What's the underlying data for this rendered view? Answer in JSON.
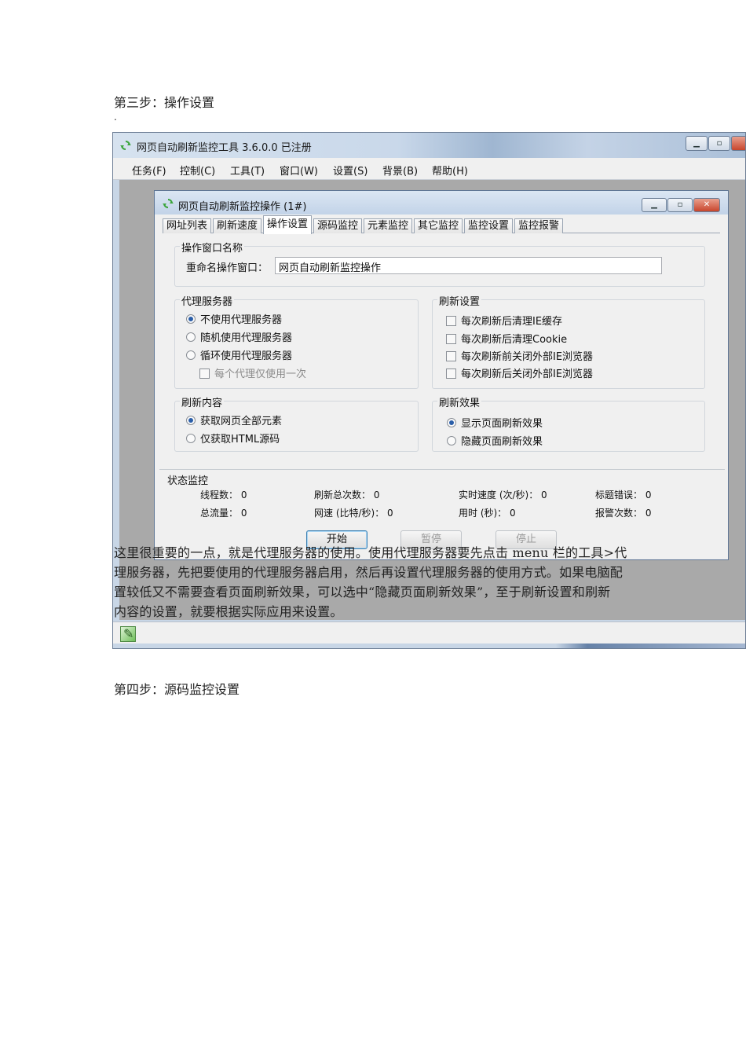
{
  "document": {
    "step3_heading": "第三步：操作设置",
    "stray_dot": ".",
    "step4_heading": "第四步：源码监控设置",
    "paragraph_lines": [
      "这里很重要的一点，就是代理服务器的使用。使用代理服务器要先点击 menu 栏的工具>代",
      "理服务器，先把要使用的代理服务器启用，然后再设置代理服务器的使用方式。如果电脑配",
      "置较低又不需要查看页面刷新效果，可以选中“隐藏页面刷新效果”，至于刷新设置和刷新",
      "内容的设置，就要根据实际应用来设置。"
    ]
  },
  "main_window": {
    "title": "网页自动刷新监控工具 3.6.0.0  已注册",
    "menu": [
      "任务(F)",
      "控制(C)",
      "工具(T)",
      "窗口(W)",
      "设置(S)",
      "背景(B)",
      "帮助(H)"
    ]
  },
  "child_window": {
    "title": "网页自动刷新监控操作  (1#)",
    "tabs": [
      "网址列表",
      "刷新速度",
      "操作设置",
      "源码监控",
      "元素监控",
      "其它监控",
      "监控设置",
      "监控报警"
    ],
    "active_tab": "操作设置",
    "rename_group": {
      "title": "操作窗口名称",
      "label": "重命名操作窗口：",
      "value": "网页自动刷新监控操作"
    },
    "proxy_group": {
      "title": "代理服务器",
      "options": [
        "不使用代理服务器",
        "随机使用代理服务器",
        "循环使用代理服务器"
      ],
      "selected": "不使用代理服务器",
      "sub_option": "每个代理仅使用一次"
    },
    "refresh_settings_group": {
      "title": "刷新设置",
      "checks": [
        "每次刷新后清理IE缓存",
        "每次刷新后清理Cookie",
        "每次刷新前关闭外部IE浏览器",
        "每次刷新后关闭外部IE浏览器"
      ]
    },
    "refresh_content_group": {
      "title": "刷新内容",
      "options": [
        "获取网页全部元素",
        "仅获取HTML源码"
      ],
      "selected": "获取网页全部元素"
    },
    "refresh_effect_group": {
      "title": "刷新效果",
      "options": [
        "显示页面刷新效果",
        "隐藏页面刷新效果"
      ],
      "selected": "显示页面刷新效果"
    },
    "status_monitor": {
      "title": "状态监控",
      "threads": "线程数： 0",
      "total_refresh": "刷新总次数： 0",
      "realtime_speed": "实时速度 (次/秒)： 0",
      "title_errors": "标题错误： 0",
      "total_traffic": "总流量： 0",
      "net_speed": "网速 (比特/秒)： 0",
      "time_used": "用时 (秒)：  0",
      "alarm_count": "报警次数： 0"
    },
    "buttons": {
      "start": "开始",
      "pause": "暂停",
      "stop": "停止"
    }
  },
  "colors": {
    "accent": "#2a5ea8",
    "mdi_background": "#a9a9a9",
    "titlebar": "#c9d8ea"
  }
}
